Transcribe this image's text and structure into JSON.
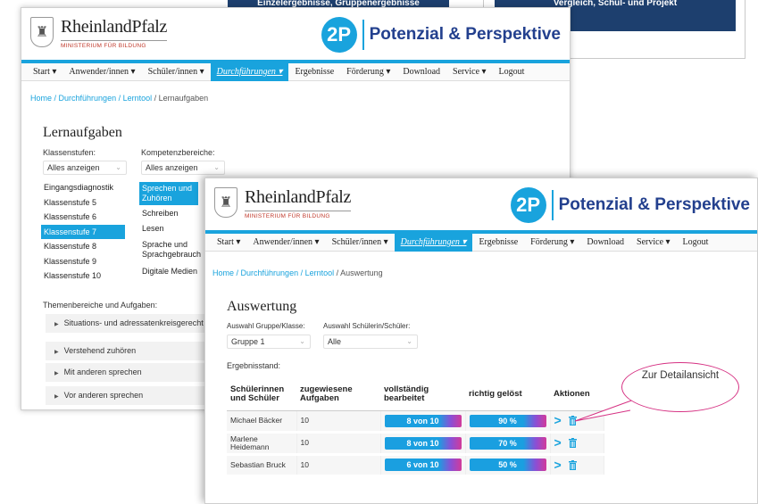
{
  "background_cards": {
    "left_bar_text": "Einzelergebnisse, Gruppenergebnisse",
    "right_bar_text": "Vergleich, Schul- und Projekt"
  },
  "window1": {
    "rlp_name": "RheinlandPfalz",
    "rlp_sub": "MINISTERIUM FÜR BILDUNG",
    "brand_badge": "2P",
    "brand_text": "Potenzial & Perspektive",
    "nav": [
      "Start ▾",
      "Anwender/innen ▾",
      "Schüler/innen ▾",
      "Durchführungen ▾",
      "Ergebnisse",
      "Förderung ▾",
      "Download",
      "Service ▾",
      "Logout"
    ],
    "nav_active_index": 3,
    "breadcrumb": {
      "home": "Home",
      "sep1": " / ",
      "l1": "Durchführungen",
      "sep2": " / ",
      "l2": "Lerntool",
      "sep3": " / ",
      "current": "Lernaufgaben"
    },
    "title": "Lernaufgaben",
    "klassenstufen_label": "Klassenstufen:",
    "klassenstufen_select": "Alles anzeigen",
    "kompetenz_label": "Kompetenzbereiche:",
    "kompetenz_select": "Alles anzeigen",
    "klassenstufen": [
      "Eingangsdiagnostik",
      "Klassenstufe 5",
      "Klassenstufe 6",
      "Klassenstufe 7",
      "Klassenstufe 8",
      "Klassenstufe 9",
      "Klassenstufe 10"
    ],
    "klassenstufen_selected": 3,
    "kompetenzen": [
      "Sprechen und Zuhören",
      "Schreiben",
      "Lesen",
      "Sprache und Sprachgebrauch",
      "Digitale Medien"
    ],
    "kompetenzen_selected": 0,
    "themen_label": "Themenbereiche und Aufgaben:",
    "themen": [
      "Situations- und adressatenkreisgerecht",
      "Verstehend zuhören",
      "Mit anderen sprechen",
      "Vor anderen sprechen"
    ]
  },
  "window2": {
    "rlp_name": "RheinlandPfalz",
    "rlp_sub": "MINISTERIUM FÜR BILDUNG",
    "brand_badge": "2P",
    "brand_text": "Potenzial & Perspektive",
    "nav": [
      "Start ▾",
      "Anwender/innen ▾",
      "Schüler/innen ▾",
      "Durchführungen ▾",
      "Ergebnisse",
      "Förderung ▾",
      "Download",
      "Service ▾",
      "Logout"
    ],
    "nav_active_index": 3,
    "breadcrumb": {
      "home": "Home",
      "sep1": " / ",
      "l1": "Durchführungen",
      "sep2": " / ",
      "l2": "Lerntool",
      "sep3": " / ",
      "current": "Auswertung"
    },
    "title": "Auswertung",
    "gruppe_label": "Auswahl Gruppe/Klasse:",
    "gruppe_select": "Gruppe 1",
    "schueler_label": "Auswahl Schülerin/Schüler:",
    "schueler_select": "Alle",
    "ergebnis_label": "Ergebnisstand:",
    "table": {
      "headers": [
        "Schülerinnen und Schüler",
        "zugewiesene Aufgaben",
        "vollständig bearbeitet",
        "richtig gelöst",
        "Aktionen"
      ],
      "rows": [
        {
          "name": "Michael Bäcker",
          "aufgaben": "10",
          "bearbeitet": "8 von 10",
          "geloest": "90 %"
        },
        {
          "name": "Marlene Heidemann",
          "aufgaben": "10",
          "bearbeitet": "8 von 10",
          "geloest": "70 %"
        },
        {
          "name": "Sebastian Bruck",
          "aufgaben": "10",
          "bearbeitet": "6 von 10",
          "geloest": "50 %"
        }
      ]
    }
  },
  "callout_text": "Zur Detailansicht",
  "colors": {
    "accent": "#19a3dd",
    "brand": "#23408e",
    "highlight": "#d63384"
  }
}
